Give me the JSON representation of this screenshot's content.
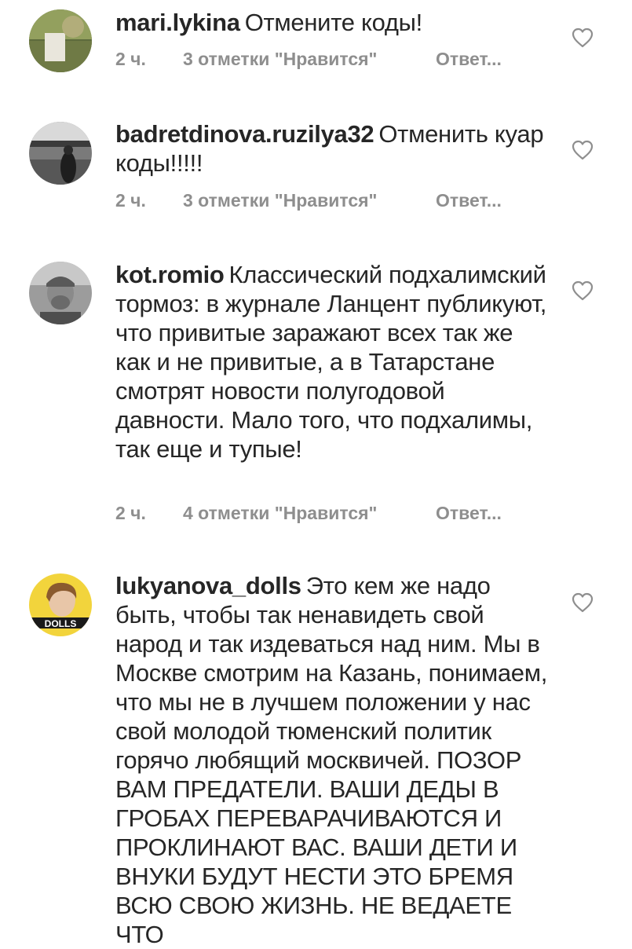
{
  "comments": [
    {
      "username": "mari.lykina",
      "text": "Отмените коды!",
      "time": "2 ч.",
      "likes": "3 отметки \"Нравится\"",
      "reply": "Ответ..."
    },
    {
      "username": "badretdinova.ruzilya32",
      "text": "Отменить куар коды!!!!!",
      "time": "2 ч.",
      "likes": "3 отметки \"Нравится\"",
      "reply": "Ответ..."
    },
    {
      "username": "kot.romio",
      "text": "Классический подхалимский тормоз: в журнале Ланцент публикуют, что привитые заражают всех так же как и не привитые, а в Татарстане смотрят новости полугодовой давности. Мало того, что подхалимы, так еще и тупые!",
      "time": "2 ч.",
      "likes": "4 отметки \"Нравится\"",
      "reply": "Ответ..."
    },
    {
      "username": "lukyanova_dolls",
      "text": "Это кем же надо быть, чтобы так ненавидеть свой народ и так издеваться над ним. Мы в Москве смотрим на Казань, понимаем, что мы не в лучшем положении у нас свой молодой тюменский политик горячо любящий москвичей. ПОЗОР ВАМ ПРЕДАТЕЛИ. ВАШИ ДЕДЫ В ГРОБАХ ПЕРЕВАРАЧИВАЮТСЯ И ПРОКЛИНАЮТ ВАС. ВАШИ ДЕТИ И ВНУКИ БУДУТ НЕСТИ ЭТО БРЕМЯ ВСЮ СВОЮ ЖИЗНЬ. НЕ ВЕДАЕТЕ ЧТО",
      "avatar_badge": "DOLLS"
    }
  ],
  "icons": {
    "like": "heart-outline-icon",
    "avatar": "user-photo"
  },
  "colors": {
    "text": "#262626",
    "meta": "#8e8e8e",
    "heart": "#8e8e8e",
    "avatar_ring_4": "#f2d43c"
  }
}
